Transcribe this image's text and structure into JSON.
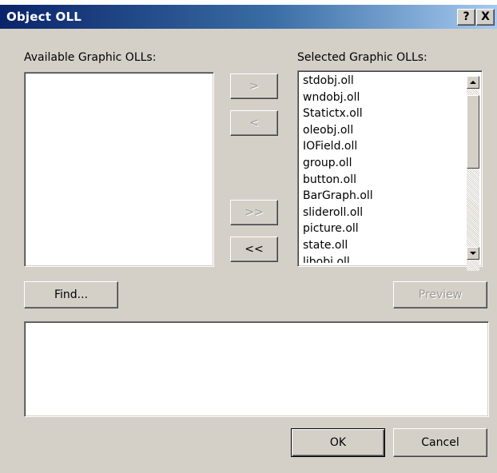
{
  "dialog": {
    "title": "Object OLL",
    "help_label": "?",
    "close_label": "X"
  },
  "available": {
    "label": "Available Graphic OLLs:",
    "items": []
  },
  "selected": {
    "label": "Selected Graphic OLLs:",
    "items": [
      "stdobj.oll",
      "wndobj.oll",
      "Statictx.oll",
      "oleobj.oll",
      "IOField.oll",
      "group.oll",
      "button.oll",
      "BarGraph.oll",
      "slideroll.oll",
      "picture.oll",
      "state.oll",
      "libobj.oll"
    ]
  },
  "transfer": {
    "add_label": ">",
    "remove_label": "<",
    "add_all_label": ">>",
    "remove_all_label": "<<"
  },
  "buttons": {
    "find_label": "Find...",
    "preview_label": "Preview",
    "ok_label": "OK",
    "cancel_label": "Cancel"
  },
  "colors": {
    "title_gradient_start": "#0a246a",
    "title_gradient_end": "#a6caf0",
    "face": "#d4d0c8"
  }
}
